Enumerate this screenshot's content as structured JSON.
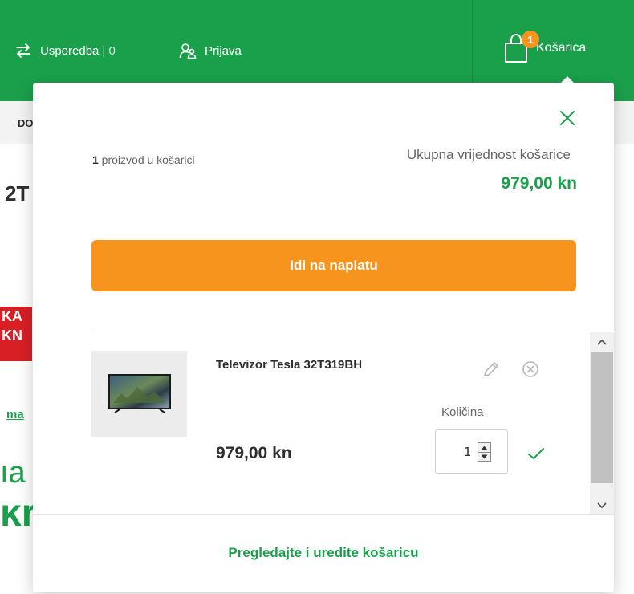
{
  "header": {
    "compare_label": "Usporedba",
    "compare_count": "| 0",
    "login_label": "Prijava",
    "cart_label": "Košarica",
    "cart_badge": "1"
  },
  "background": {
    "subnav_fragment": "DO",
    "heading_fragment": "2T",
    "promo_line1": "KA",
    "promo_line2": "KN",
    "link_fragment": "ma",
    "text_fragment1": "ıa",
    "text_fragment2": "ĸr"
  },
  "minicart": {
    "items_count": "1",
    "items_count_suffix": " proizvod u košarici",
    "total_label": "Ukupna vrijednost košarice",
    "total_value": "979,00 kn",
    "checkout_label": "Idi na naplatu",
    "items": [
      {
        "name": "Televizor Tesla 32T319BH",
        "price": "979,00 kn",
        "quantity_label": "Količina",
        "quantity": "1"
      }
    ],
    "review_label": "Pregledajte i uredite košaricu"
  },
  "colors": {
    "brand_green": "#1aa04a",
    "accent_orange": "#f7941d"
  },
  "icons": {
    "compare": "compare-arrows-icon",
    "login": "users-icon",
    "cart": "shopping-bag-icon",
    "close": "close-icon",
    "edit": "pencil-icon",
    "remove": "remove-circle-icon",
    "confirm": "checkmark-icon"
  }
}
